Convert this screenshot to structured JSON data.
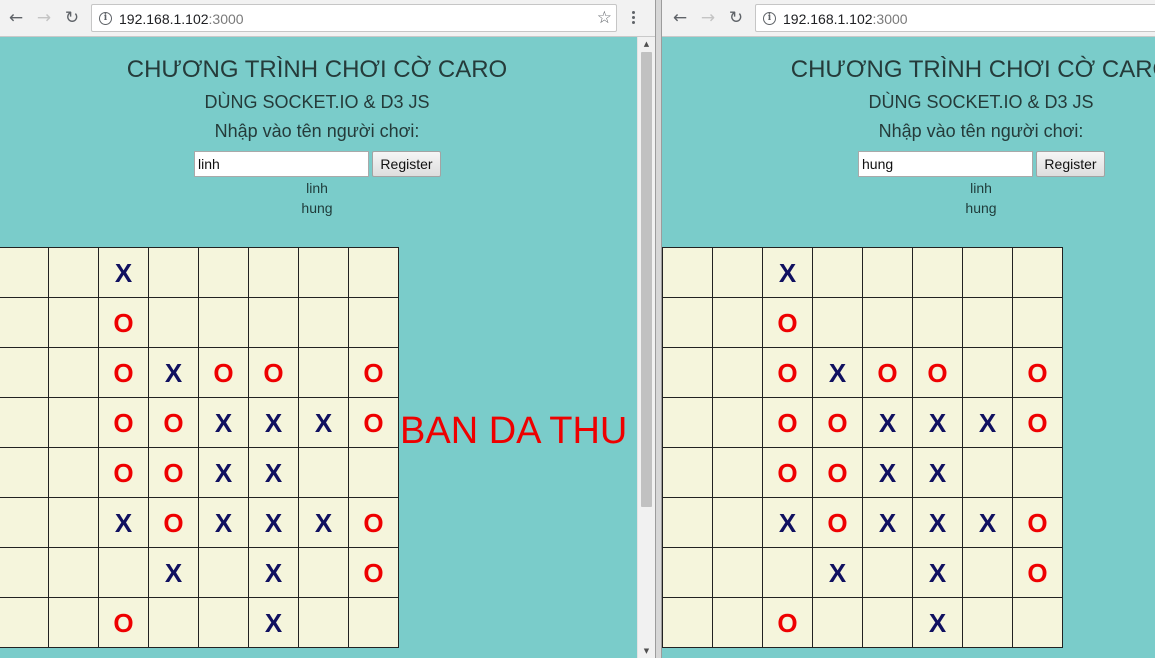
{
  "app": {
    "title": "CHƯƠNG TRÌNH CHƠI CỜ CARO",
    "subtitle": "DÙNG SOCKET.IO & D3 JS",
    "prompt": "Nhập vào tên người chơi:",
    "register_label": "Register"
  },
  "windows": [
    {
      "id": "left",
      "url_host": "192.168.1.102",
      "url_port": ":3000",
      "name_value": "linh",
      "players": [
        "linh",
        "hung"
      ],
      "result_text": "BAN DA THU"
    },
    {
      "id": "right",
      "url_host": "192.168.1.102",
      "url_port": ":3000",
      "name_value": "hung",
      "players": [
        "linh",
        "hung"
      ],
      "result_text": ""
    }
  ],
  "board": [
    [
      "",
      "",
      "X",
      "",
      "",
      "",
      "",
      ""
    ],
    [
      "",
      "",
      "O",
      "",
      "",
      "",
      "",
      ""
    ],
    [
      "",
      "",
      "O",
      "X",
      "O",
      "O",
      "",
      "O"
    ],
    [
      "",
      "",
      "O",
      "O",
      "X",
      "X",
      "X",
      "O"
    ],
    [
      "",
      "",
      "O",
      "O",
      "X",
      "X",
      "",
      ""
    ],
    [
      "",
      "",
      "X",
      "O",
      "X",
      "X",
      "X",
      "O"
    ],
    [
      "",
      "",
      "",
      "X",
      "",
      "X",
      "",
      "O"
    ],
    [
      "",
      "",
      "O",
      "",
      "",
      "X",
      "",
      ""
    ]
  ],
  "colors": {
    "background": "#7accca",
    "cell": "#f5f5dc",
    "x_mark": "#101060",
    "o_mark": "#ee0000",
    "result": "#ee0000"
  },
  "icons": [
    "back-arrow-icon",
    "forward-arrow-icon",
    "reload-icon",
    "info-icon",
    "star-icon",
    "menu-dots-icon"
  ]
}
